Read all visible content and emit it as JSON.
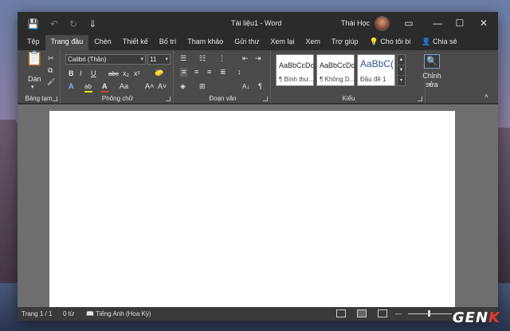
{
  "window": {
    "title": "Tài liệu1 - Word",
    "user_name": "Thái Học",
    "minimize": "—",
    "restore": "☐",
    "close": "✕",
    "ribbon_display": "▭"
  },
  "qat": {
    "save": "💾",
    "undo": "↶",
    "undo_dd": "▾",
    "redo": "↻",
    "customize": "⇓"
  },
  "tabs": [
    {
      "label": "Tệp"
    },
    {
      "label": "Trang đầu"
    },
    {
      "label": "Chèn"
    },
    {
      "label": "Thiết kế"
    },
    {
      "label": "Bố trí"
    },
    {
      "label": "Tham khảo"
    },
    {
      "label": "Gửi thư"
    },
    {
      "label": "Xem lại"
    },
    {
      "label": "Xem"
    },
    {
      "label": "Trợ giúp"
    },
    {
      "label": "Cho tôi bi"
    },
    {
      "label": "Chia sẻ"
    }
  ],
  "ribbon": {
    "clipboard": {
      "label": "Bảng tạm",
      "paste": "Dán",
      "paste_dd": "▾",
      "cut": "✂",
      "copy": "⧉",
      "format_painter": "🖌"
    },
    "font": {
      "label": "Phông chữ",
      "font_name": "Calibri (Thân)",
      "font_size": "11",
      "bold": "B",
      "italic": "I",
      "underline": "U",
      "strike": "abc",
      "subscript": "x₂",
      "superscript": "x²",
      "clear": "🧽",
      "text_effects": "A",
      "highlight": "ab",
      "font_color": "A",
      "change_case": "Aa",
      "grow": "A˄",
      "shrink": "A˅"
    },
    "paragraph": {
      "label": "Đoạn văn",
      "bullets": "☰",
      "numbering": "☷",
      "multilevel": "⋮",
      "decrease_indent": "⇤",
      "increase_indent": "⇥",
      "align_left": "≡",
      "align_center": "≡",
      "align_right": "≡",
      "justify": "≣",
      "line_spacing": "↕",
      "sort": "A↓",
      "show_marks": "¶",
      "shading": "◈",
      "borders": "⊞"
    },
    "styles": {
      "label": "Kiểu",
      "items": [
        {
          "sample": "AaBbCcDc",
          "name": "¶ Bình thư..."
        },
        {
          "sample": "AaBbCcDc",
          "name": "¶ Không D..."
        },
        {
          "sample": "AaBbC(",
          "name": "Đầu đề 1"
        }
      ],
      "scroll_up": "▲",
      "scroll_down": "▼",
      "more": "▾"
    },
    "editing": {
      "label": "Chỉnh sửa",
      "dd": "▾",
      "icon": "🔍"
    }
  },
  "status": {
    "page": "Trang 1 / 1",
    "words": "0 từ",
    "language": "Tiếng Anh (Hoa Kỳ)",
    "zoom": "— "
  },
  "watermark": {
    "text": "GEN",
    "accent": "K"
  },
  "colors": {
    "accent_highlight": "#f0e000",
    "font_color_bar": "#e23a2c",
    "heading_blue": "#2f5597"
  }
}
